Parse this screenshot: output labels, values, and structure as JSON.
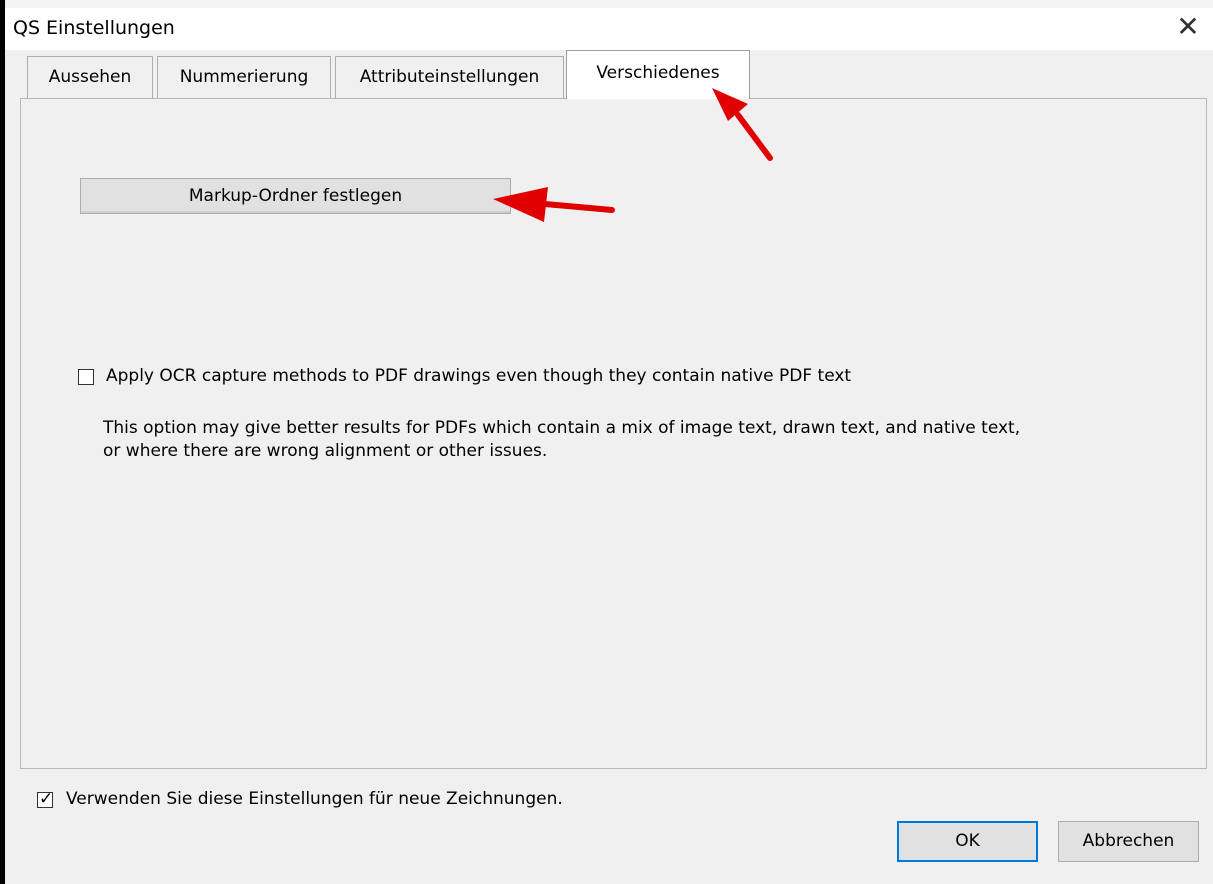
{
  "window": {
    "title": "QS Einstellungen",
    "close_glyph": "✕"
  },
  "tabs": [
    {
      "label": "Aussehen",
      "active": false
    },
    {
      "label": "Nummerierung",
      "active": false
    },
    {
      "label": "Attributeinstellungen",
      "active": false
    },
    {
      "label": "Verschiedenes",
      "active": true
    }
  ],
  "panel": {
    "markup_button_label": "Markup-Ordner festlegen",
    "ocr_option": {
      "label": "Apply OCR capture methods to PDF drawings even though they contain native PDF text",
      "checked": false
    },
    "ocr_description": [
      "This option may give better results for PDFs which contain a mix of image text, drawn text, and native text,",
      "or where there are wrong alignment or other issues."
    ]
  },
  "footer": {
    "use_for_new_drawings": {
      "label": "Verwenden Sie diese Einstellungen für neue Zeichnungen.",
      "checked": true
    },
    "ok_label": "OK",
    "cancel_label": "Abbrechen"
  },
  "annotations": {
    "arrow_color": "#e00000"
  }
}
